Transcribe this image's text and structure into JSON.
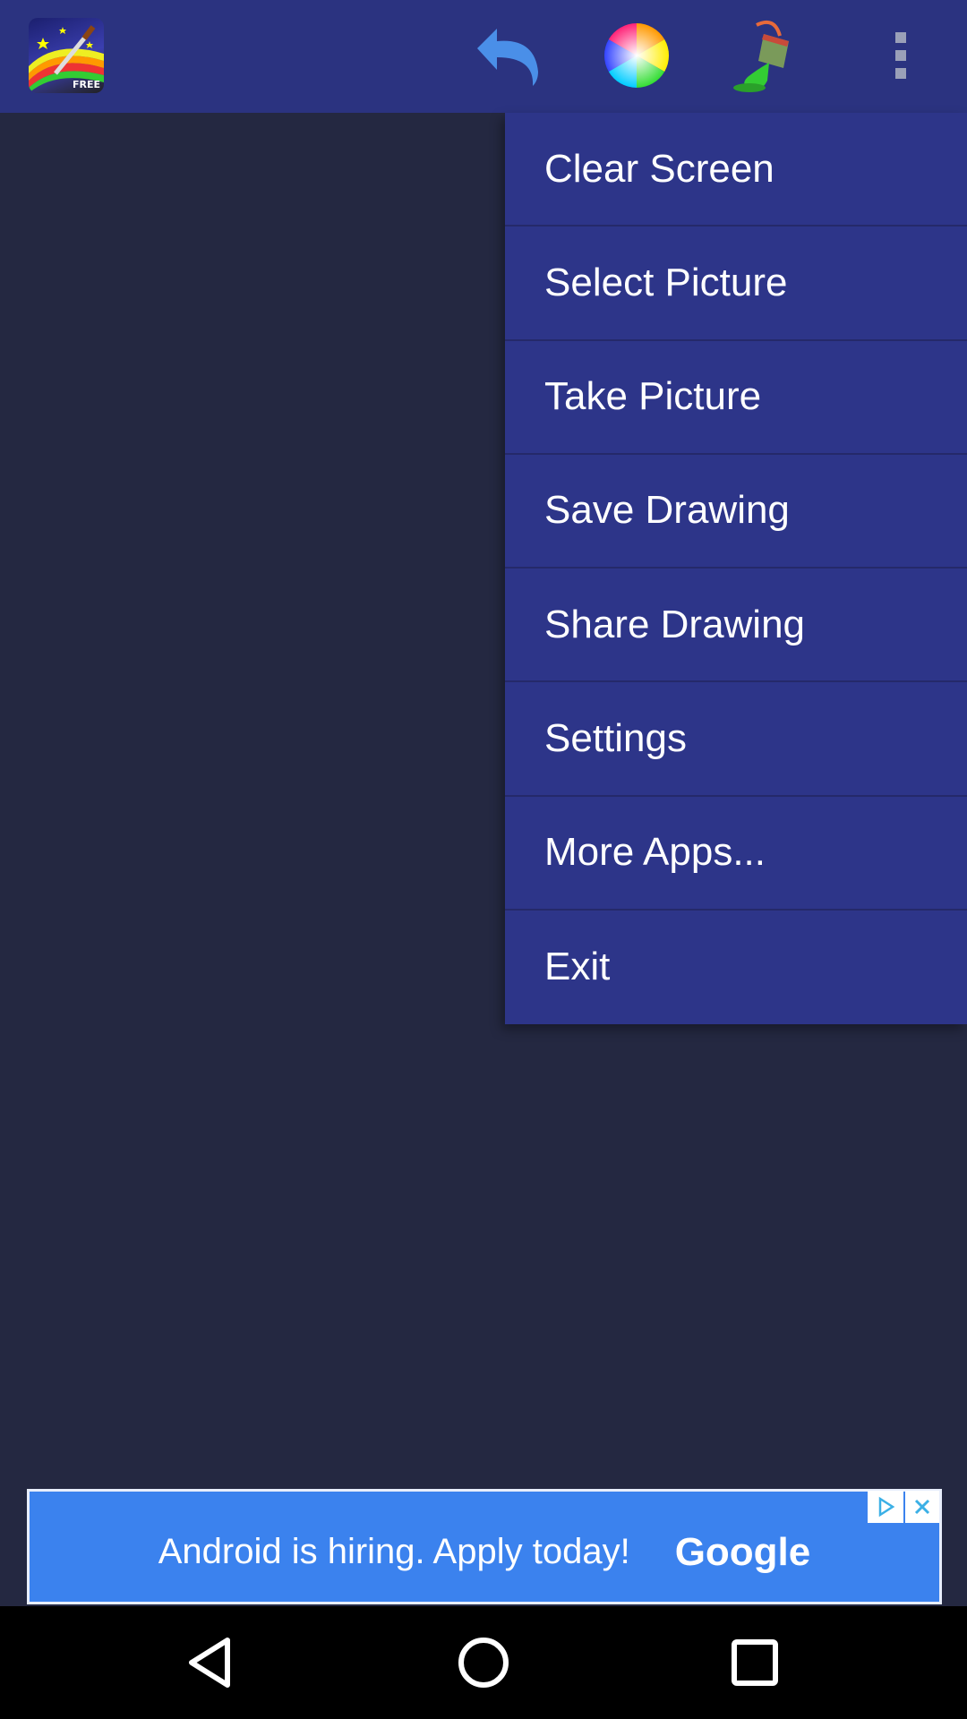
{
  "app": {
    "icon_badge": "FREE"
  },
  "action_bar": {
    "icons": [
      "app-logo-icon",
      "undo-icon",
      "color-wheel-icon",
      "paint-bucket-icon",
      "overflow-menu-icon"
    ]
  },
  "menu": {
    "items": [
      {
        "label": "Clear Screen"
      },
      {
        "label": "Select Picture"
      },
      {
        "label": "Take Picture"
      },
      {
        "label": "Save Drawing"
      },
      {
        "label": "Share Drawing"
      },
      {
        "label": "Settings"
      },
      {
        "label": "More Apps..."
      },
      {
        "label": "Exit"
      }
    ]
  },
  "ad": {
    "text": "Android is hiring. Apply today!",
    "brand": "Google"
  },
  "colors": {
    "background": "#242841",
    "action_bar": "#2b3380",
    "menu": "#2d3589",
    "ad_banner": "#3b82ee"
  }
}
